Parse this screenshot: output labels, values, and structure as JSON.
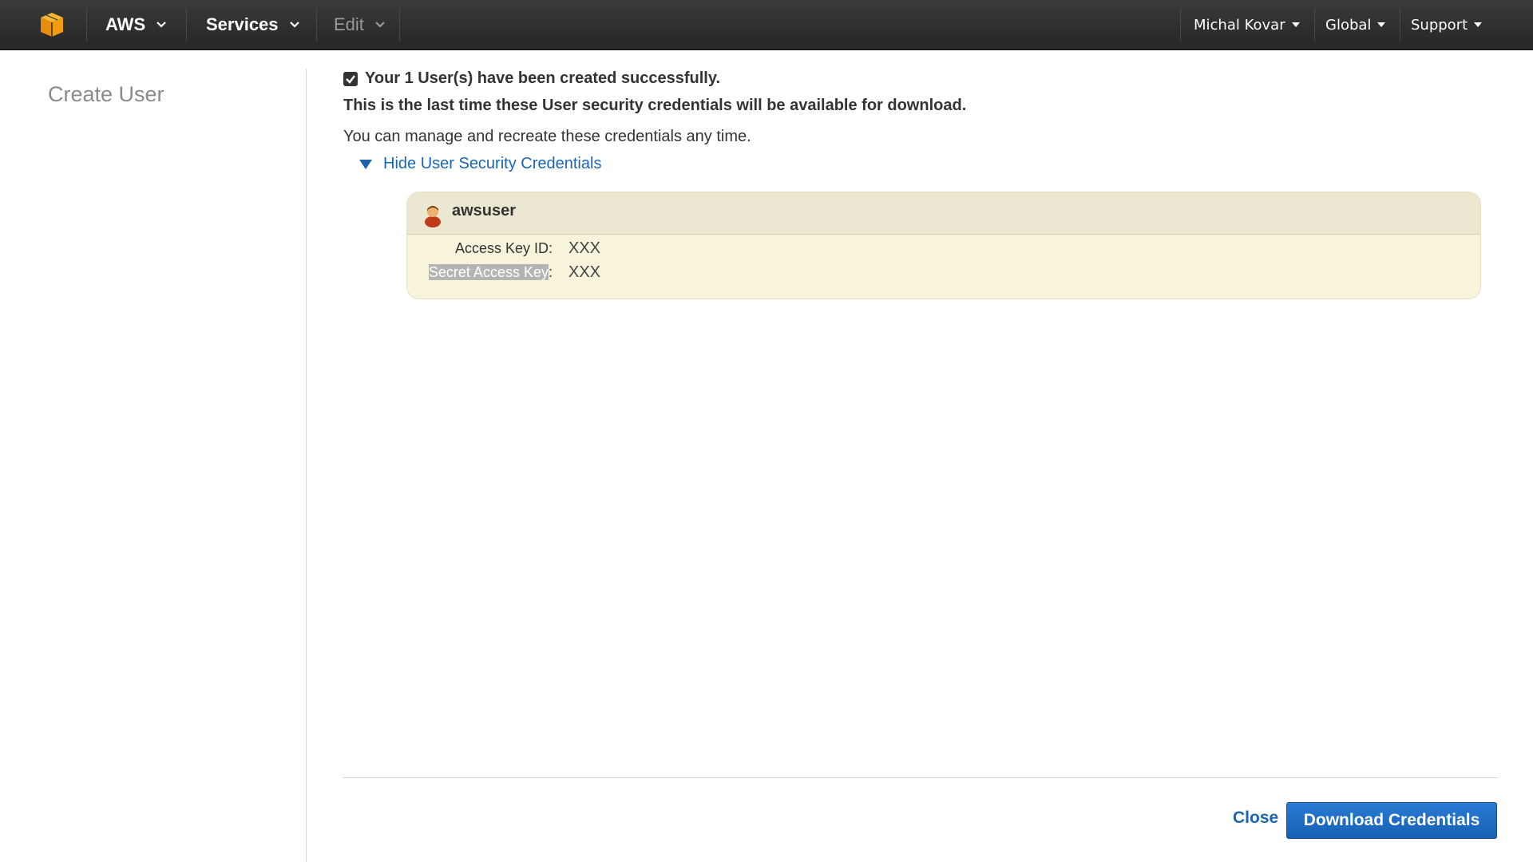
{
  "topbar": {
    "brand": "AWS",
    "services": "Services",
    "edit": "Edit",
    "account": "Michal Kovar",
    "region": "Global",
    "support": "Support",
    "logo_icon": "aws-cube-icon"
  },
  "sidebar": {
    "title": "Create User"
  },
  "main": {
    "success_message": "Your 1 User(s) have been created successfully.",
    "warning_message": "This is the last time these User security credentials will be available for download.",
    "manage_message": "You can manage and recreate these credentials any time.",
    "toggle_label": "Hide User Security Credentials",
    "credentials": {
      "username": "awsuser",
      "access_key_label": "Access Key ID:",
      "access_key_value": "XXX",
      "secret_key_label_selected": "Secret Access Key",
      "secret_key_label_suffix": ":",
      "secret_key_value": "XXX"
    }
  },
  "footer": {
    "close_label": "Close",
    "download_label": "Download Credentials"
  },
  "colors": {
    "topbar": "#2f2f2f",
    "link": "#1a66b3",
    "primary_button": "#1f6cc4",
    "credential_panel": "#f8f4dc",
    "aws_orange": "#f39c12"
  }
}
